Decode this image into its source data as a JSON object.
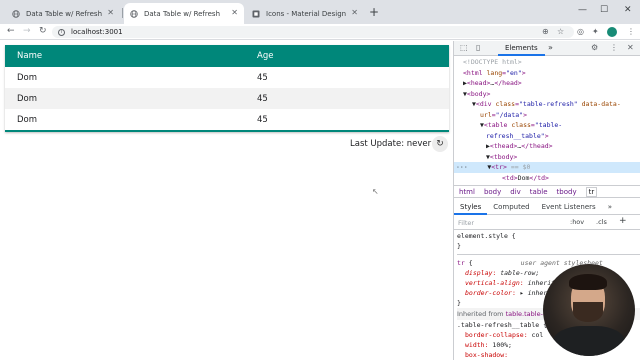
{
  "tabs": [
    {
      "title": "Data Table w/ Refresh",
      "active": false
    },
    {
      "title": "Data Table w/ Refresh",
      "active": true
    },
    {
      "title": "Icons - Material Design",
      "active": false
    }
  ],
  "toolbar": {
    "url": "localhost:3001"
  },
  "table": {
    "headers": [
      "Name",
      "Age"
    ],
    "rows": [
      {
        "name": "Dom",
        "age": "45"
      },
      {
        "name": "Dom",
        "age": "45"
      },
      {
        "name": "Dom",
        "age": "45"
      }
    ]
  },
  "status": {
    "last_update_label": "Last Update: never"
  },
  "devtools": {
    "active_tab": "Elements",
    "more_tabs": "»",
    "breadcrumbs": [
      "html",
      "body",
      "div",
      "table",
      "tbody",
      "tr"
    ],
    "subtabs": [
      "Styles",
      "Computed",
      "Event Listeners",
      "»"
    ],
    "filter_placeholder": "Filter",
    "filter_hov": ":hov",
    "filter_cls": ".cls",
    "dom_selected_marker": "== $0",
    "inherited_from_label": "Inherited from",
    "inherited_from_tag": "table.table-ref"
  },
  "colors": {
    "accent": "#00877a",
    "row_alt": "#f2f2f2"
  }
}
